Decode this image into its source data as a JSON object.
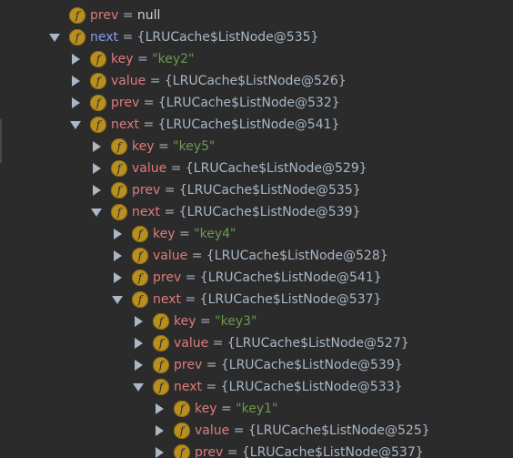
{
  "colors": {
    "background": "#2b2b2b",
    "field_name": "#e17b7b",
    "field_name_selected": "#8b97f5",
    "string_value": "#6a9a4f",
    "object_value": "#a9b7c6",
    "field_badge": "#b9901f"
  },
  "icons": {
    "field_badge": "field-icon",
    "expand_arrow": "triangle-right-icon",
    "collapse_arrow": "triangle-down-icon"
  },
  "badge_glyph": "f",
  "equals": "=",
  "variables": [
    {
      "name": "prev",
      "value": "null",
      "kind": "null",
      "state": "leaf"
    },
    {
      "name": "next",
      "value": "{LRUCache$ListNode@535}",
      "kind": "obj",
      "state": "expanded",
      "highlight": true
    },
    {
      "name": "key",
      "value": "\"key2\"",
      "kind": "str",
      "state": "collapsed"
    },
    {
      "name": "value",
      "value": "{LRUCache$ListNode@526}",
      "kind": "obj",
      "state": "collapsed"
    },
    {
      "name": "prev",
      "value": "{LRUCache$ListNode@532}",
      "kind": "obj",
      "state": "collapsed"
    },
    {
      "name": "next",
      "value": "{LRUCache$ListNode@541}",
      "kind": "obj",
      "state": "expanded"
    },
    {
      "name": "key",
      "value": "\"key5\"",
      "kind": "str",
      "state": "collapsed"
    },
    {
      "name": "value",
      "value": "{LRUCache$ListNode@529}",
      "kind": "obj",
      "state": "collapsed"
    },
    {
      "name": "prev",
      "value": "{LRUCache$ListNode@535}",
      "kind": "obj",
      "state": "collapsed"
    },
    {
      "name": "next",
      "value": "{LRUCache$ListNode@539}",
      "kind": "obj",
      "state": "expanded"
    },
    {
      "name": "key",
      "value": "\"key4\"",
      "kind": "str",
      "state": "collapsed"
    },
    {
      "name": "value",
      "value": "{LRUCache$ListNode@528}",
      "kind": "obj",
      "state": "collapsed"
    },
    {
      "name": "prev",
      "value": "{LRUCache$ListNode@541}",
      "kind": "obj",
      "state": "collapsed"
    },
    {
      "name": "next",
      "value": "{LRUCache$ListNode@537}",
      "kind": "obj",
      "state": "expanded"
    },
    {
      "name": "key",
      "value": "\"key3\"",
      "kind": "str",
      "state": "collapsed"
    },
    {
      "name": "value",
      "value": "{LRUCache$ListNode@527}",
      "kind": "obj",
      "state": "collapsed"
    },
    {
      "name": "prev",
      "value": "{LRUCache$ListNode@539}",
      "kind": "obj",
      "state": "collapsed"
    },
    {
      "name": "next",
      "value": "{LRUCache$ListNode@533}",
      "kind": "obj",
      "state": "expanded"
    },
    {
      "name": "key",
      "value": "\"key1\"",
      "kind": "str",
      "state": "collapsed"
    },
    {
      "name": "value",
      "value": "{LRUCache$ListNode@525}",
      "kind": "obj",
      "state": "collapsed"
    },
    {
      "name": "prev",
      "value": "{LRUCache$ListNode@537}",
      "kind": "obj",
      "state": "collapsed"
    }
  ]
}
